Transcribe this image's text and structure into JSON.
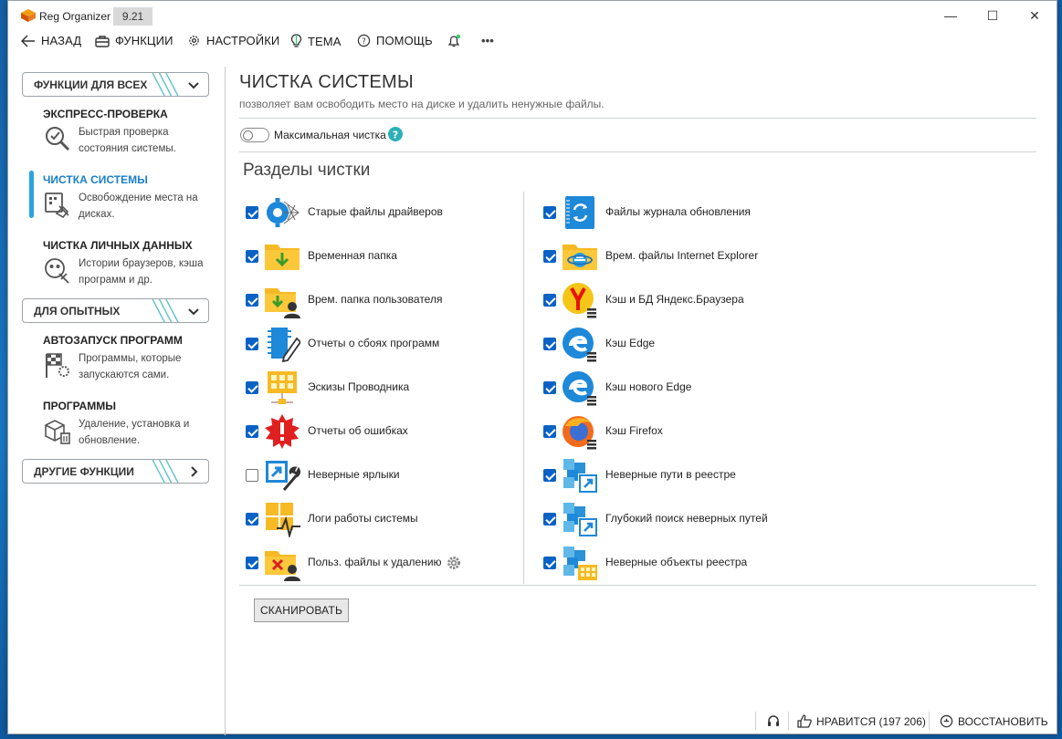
{
  "window": {
    "app_title": "Reg Organizer",
    "version": "9.21",
    "controls": {
      "minimize": "—",
      "maximize": "☐",
      "close": "✕"
    }
  },
  "toolbar": {
    "back": "НАЗАД",
    "functions": "ФУНКЦИИ",
    "settings": "НАСТРОЙКИ",
    "theme": "ТЕМА",
    "help": "ПОМОЩЬ",
    "more": "•••"
  },
  "sidebar": {
    "section_all": "ФУНКЦИИ ДЛЯ ВСЕХ",
    "section_expert": "ДЛЯ ОПЫТНЫХ",
    "section_other": "ДРУГИЕ ФУНКЦИИ",
    "items": [
      {
        "title": "ЭКСПРЕСС-ПРОВЕРКА",
        "desc": "Быстрая проверка состояния системы."
      },
      {
        "title": "ЧИСТКА СИСТЕМЫ",
        "desc": "Освобождение места на дисках."
      },
      {
        "title": "ЧИСТКА ЛИЧНЫХ ДАННЫХ",
        "desc": "Истории браузеров, кэша программ и др."
      },
      {
        "title": "АВТОЗАПУСК ПРОГРАММ",
        "desc": "Программы, которые запускаются сами."
      },
      {
        "title": "ПРОГРАММЫ",
        "desc": "Удаление, установка и обновление."
      }
    ]
  },
  "main": {
    "title": "ЧИСТКА СИСТЕМЫ",
    "subtitle": "позволяет вам освободить место на диске и удалить ненужные файлы.",
    "max_clean_label": "Максимальная чистка",
    "sections_title": "Разделы чистки",
    "left_items": [
      {
        "label": "Старые файлы драйверов",
        "checked": true
      },
      {
        "label": "Временная папка",
        "checked": true
      },
      {
        "label": "Врем. папка пользователя",
        "checked": true
      },
      {
        "label": "Отчеты о сбоях программ",
        "checked": true
      },
      {
        "label": "Эскизы Проводника",
        "checked": true
      },
      {
        "label": "Отчеты об ошибках",
        "checked": true
      },
      {
        "label": "Неверные ярлыки",
        "checked": false
      },
      {
        "label": "Логи работы системы",
        "checked": true
      },
      {
        "label": "Польз. файлы к удалению",
        "checked": true
      }
    ],
    "right_items": [
      {
        "label": "Файлы журнала обновления",
        "checked": true
      },
      {
        "label": "Врем. файлы Internet Explorer",
        "checked": true
      },
      {
        "label": "Кэш и БД Яндекс.Браузера",
        "checked": true
      },
      {
        "label": "Кэш Edge",
        "checked": true
      },
      {
        "label": "Кэш нового Edge",
        "checked": true
      },
      {
        "label": "Кэш Firefox",
        "checked": true
      },
      {
        "label": "Неверные пути в реестре",
        "checked": true
      },
      {
        "label": "Глубокий поиск неверных путей",
        "checked": true
      },
      {
        "label": "Неверные объекты реестра",
        "checked": true
      }
    ],
    "scan_button": "СКАНИРОВАТЬ"
  },
  "statusbar": {
    "like": "НРАВИТСЯ (197 206)",
    "restore": "ВОССТАНОВИТЬ"
  },
  "colors": {
    "accent": "#1a7fc8",
    "checkbox": "#0a62c5",
    "folder": "#f7b924",
    "blue_icon": "#1e88d9"
  }
}
